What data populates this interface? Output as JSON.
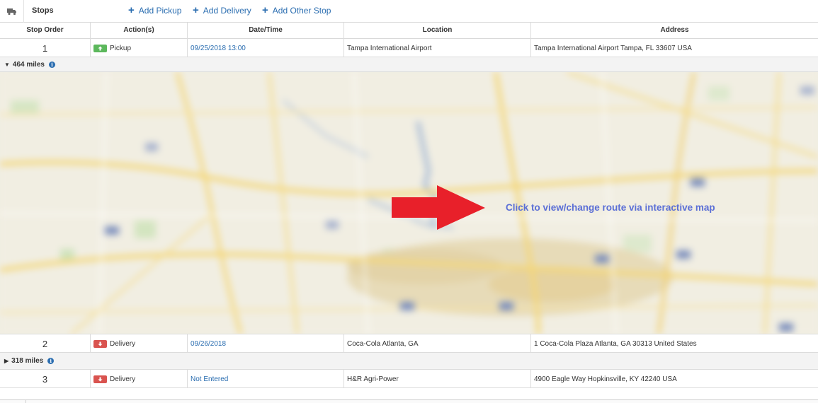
{
  "toolbar": {
    "title": "Stops",
    "icon": "truck-icon",
    "add_pickup": "Add Pickup",
    "add_delivery": "Add Delivery",
    "add_other": "Add Other Stop"
  },
  "columns": [
    "Stop Order",
    "Action(s)",
    "Date/Time",
    "Location",
    "Address"
  ],
  "stops": [
    {
      "order": "1",
      "action": "Pickup",
      "action_color": "#5cb85c",
      "action_icon": "arrow-up-icon",
      "datetime": "09/25/2018 13:00",
      "location": "Tampa International Airport",
      "address": "Tampa International Airport Tampa, FL 33607 USA"
    },
    {
      "order": "2",
      "action": "Delivery",
      "action_color": "#d9534f",
      "action_icon": "arrow-down-icon",
      "datetime": "09/26/2018",
      "location": "Coca-Cola Atlanta, GA",
      "address": "1 Coca-Cola Plaza Atlanta, GA 30313 United States"
    },
    {
      "order": "3",
      "action": "Delivery",
      "action_color": "#d9534f",
      "action_icon": "arrow-down-icon",
      "datetime": "Not Entered",
      "location": "H&R Agri-Power",
      "address": "4900 Eagle Way Hopkinsville, KY 42240 USA"
    }
  ],
  "legs": [
    {
      "caret": "▼",
      "miles": "464 miles",
      "expanded": true
    },
    {
      "caret": "▶",
      "miles": "318 miles",
      "expanded": false
    }
  ],
  "map": {
    "cta": "Click to view/change route via interactive map",
    "arrow_color": "#e8202a",
    "cta_color": "#5b6fd6"
  },
  "colors": {
    "link": "#2a6db0",
    "pickup": "#5cb85c",
    "delivery": "#d9534f"
  }
}
